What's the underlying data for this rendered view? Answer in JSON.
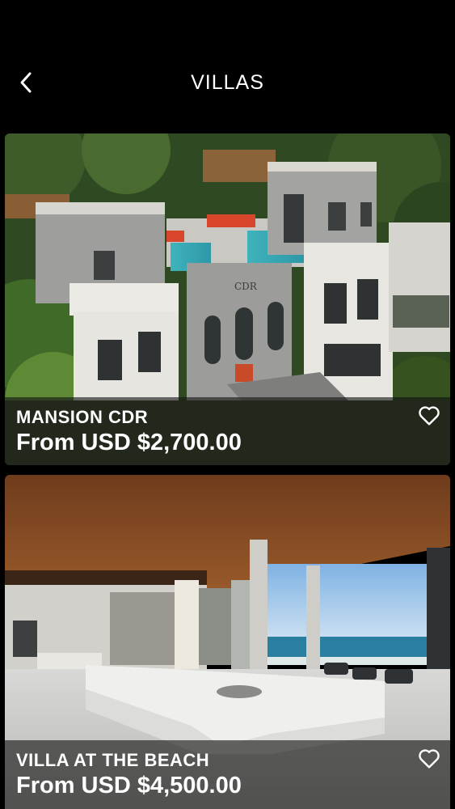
{
  "header": {
    "title": "VILLAS",
    "back_icon": "chevron-left-icon"
  },
  "listings": [
    {
      "name": "MANSION CDR",
      "price": "From USD $2,700.00",
      "favorite_icon": "heart-outline-icon",
      "sign_text": "CDR"
    },
    {
      "name": "VILLA AT THE BEACH",
      "price": "From USD $4,500.00",
      "favorite_icon": "heart-outline-icon"
    }
  ]
}
